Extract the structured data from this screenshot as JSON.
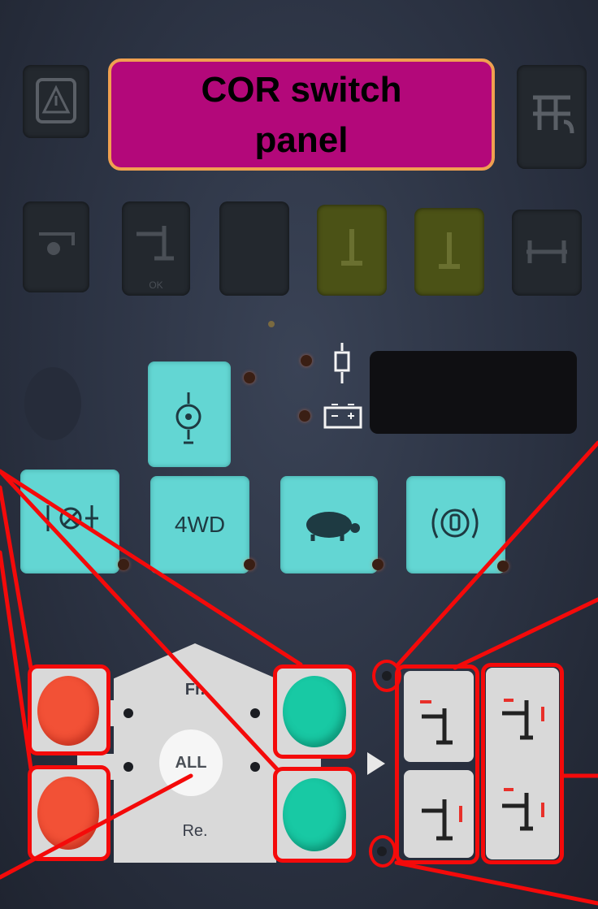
{
  "title_box": {
    "line1": "COR switch",
    "line2": "panel",
    "bg": "#b3087a",
    "border": "#f0a050"
  },
  "top_row_icons": [
    "warning-icon",
    "gear-shift-icon"
  ],
  "second_row_icons": [
    "level-icon",
    "axle-ok-icon",
    "blank",
    "lift-icon",
    "jack-icon",
    "axle-icon"
  ],
  "second_row_sublabel": "OK",
  "status_indicators": [
    "oil-filter-icon",
    "battery-icon"
  ],
  "function_buttons": [
    {
      "icon": "engine-preheat-icon",
      "label": ""
    },
    {
      "icon": "differential-lock-icon",
      "label": ""
    },
    {
      "icon": "four-wheel-drive-icon",
      "label": "4WD"
    },
    {
      "icon": "turtle-slow-icon",
      "label": ""
    },
    {
      "icon": "parking-brake-icon",
      "label": ""
    }
  ],
  "axle_selector": {
    "front_label": "Fr.",
    "all_label": "ALL",
    "rear_label": "Re."
  },
  "colors": {
    "annotation_red": "#f40a0a",
    "cyan_button": "#63d6d3",
    "red_button": "#f25136",
    "green_button": "#18c9a4",
    "plate_gray": "#d9d9d9"
  }
}
